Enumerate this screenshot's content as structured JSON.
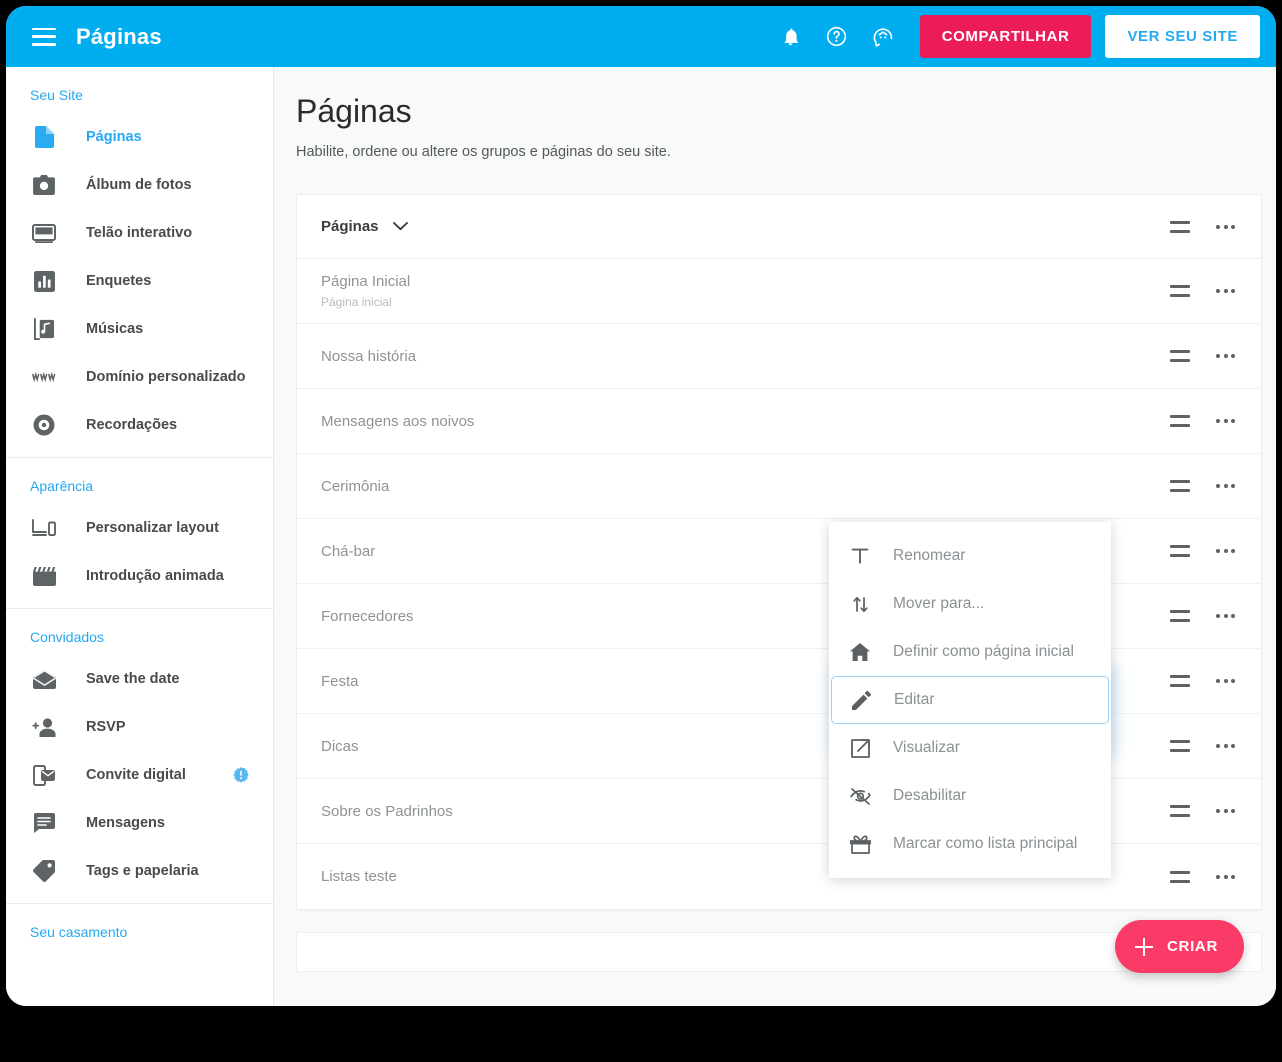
{
  "colors": {
    "brand_blue": "#00AEF0",
    "accent_pink": "#EC1B5A",
    "fab_pink": "#FB3B67",
    "link_blue": "#24A9F2",
    "content_bg": "#F8F9F9"
  },
  "topbar": {
    "title": "Páginas",
    "menu_icon": "hamburger-icon",
    "notifications_icon": "bell-icon",
    "help_icon": "help-circle-icon",
    "support_icon": "support-agent-icon",
    "share_label": "COMPARTILHAR",
    "view_site_label": "VER SEU SITE"
  },
  "sidebar": {
    "groups": [
      {
        "heading": "Seu Site",
        "items": [
          {
            "label": "Páginas",
            "icon": "document-icon",
            "active": true
          },
          {
            "label": "Álbum de fotos",
            "icon": "camera-icon",
            "active": false
          },
          {
            "label": "Telão interativo",
            "icon": "screen-icon",
            "active": false
          },
          {
            "label": "Enquetes",
            "icon": "bar-chart-icon",
            "active": false
          },
          {
            "label": "Músicas",
            "icon": "music-note-icon",
            "active": false
          },
          {
            "label": "Domínio personalizado",
            "icon": "www-icon",
            "active": false
          },
          {
            "label": "Recordações",
            "icon": "disc-icon",
            "active": false
          }
        ]
      },
      {
        "heading": "Aparência",
        "items": [
          {
            "label": "Personalizar layout",
            "icon": "devices-icon",
            "active": false
          },
          {
            "label": "Introdução animada",
            "icon": "clapperboard-icon",
            "active": false
          }
        ]
      },
      {
        "heading": "Convidados",
        "items": [
          {
            "label": "Save the date",
            "icon": "envelope-open-icon",
            "active": false
          },
          {
            "label": "RSVP",
            "icon": "person-add-icon",
            "active": false
          },
          {
            "label": "Convite digital",
            "icon": "mobile-message-icon",
            "active": false,
            "badge": "alert-badge"
          },
          {
            "label": "Mensagens",
            "icon": "chat-lines-icon",
            "active": false
          },
          {
            "label": "Tags e papelaria",
            "icon": "tag-icon",
            "active": false
          }
        ]
      },
      {
        "heading": "Seu casamento",
        "items": []
      }
    ]
  },
  "main": {
    "title": "Páginas",
    "subtitle": "Habilite, ordene ou altere os grupos e páginas do seu site.",
    "card": {
      "group_title": "Páginas",
      "chevron_icon": "chevron-down-icon",
      "handle_icon": "drag-handle-icon",
      "more_icon": "more-options-icon",
      "rows": [
        {
          "title": "Página Inicial",
          "subtitle": "Página inicial"
        },
        {
          "title": "Nossa história",
          "subtitle": ""
        },
        {
          "title": "Mensagens aos noivos",
          "subtitle": ""
        },
        {
          "title": "Cerimônia",
          "subtitle": ""
        },
        {
          "title": "Chá-bar",
          "subtitle": ""
        },
        {
          "title": "Fornecedores",
          "subtitle": ""
        },
        {
          "title": "Festa",
          "subtitle": ""
        },
        {
          "title": "Dicas",
          "subtitle": ""
        },
        {
          "title": "Sobre os Padrinhos",
          "subtitle": ""
        },
        {
          "title": "Listas teste",
          "subtitle": ""
        }
      ]
    }
  },
  "context_menu": {
    "items": [
      {
        "label": "Renomear",
        "icon": "text-format-icon",
        "selected": false
      },
      {
        "label": "Mover para...",
        "icon": "move-updown-icon",
        "selected": false
      },
      {
        "label": "Definir como página inicial",
        "icon": "home-icon",
        "selected": false
      },
      {
        "label": "Editar",
        "icon": "pencil-icon",
        "selected": true
      },
      {
        "label": "Visualizar",
        "icon": "external-link-icon",
        "selected": false
      },
      {
        "label": "Desabilitar",
        "icon": "eye-off-icon",
        "selected": false
      },
      {
        "label": "Marcar como lista principal",
        "icon": "gift-icon",
        "selected": false
      }
    ]
  },
  "fab": {
    "label": "CRIAR",
    "icon": "plus-icon"
  }
}
